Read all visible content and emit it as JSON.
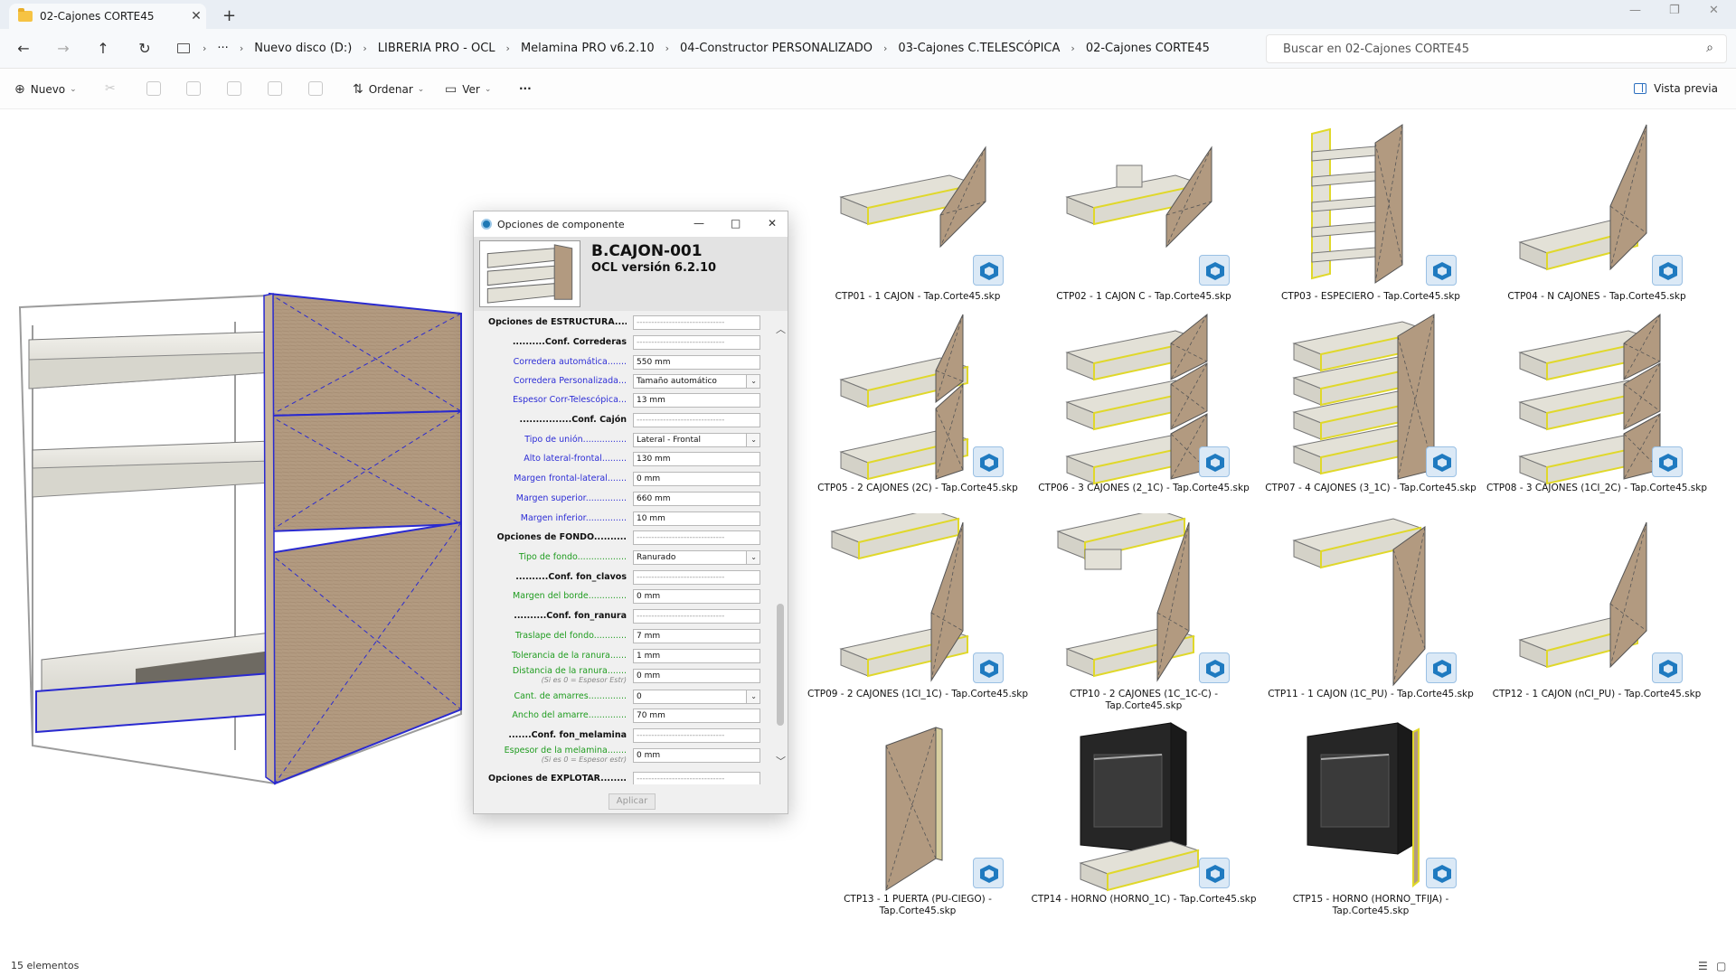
{
  "tab": {
    "title": "02-Cajones CORTE45",
    "close": "✕",
    "new": "+"
  },
  "window": {
    "minimize": "—",
    "restore": "❐",
    "close": "✕"
  },
  "nav": {
    "back": "←",
    "forward": "→",
    "up": "↑",
    "refresh": "↻",
    "more": "···",
    "sep": "›",
    "breadcrumbs": [
      "Nuevo disco (D:)",
      "LIBRERIA PRO - OCL",
      "Melamina PRO v6.2.10",
      "04-Constructor PERSONALIZADO",
      "03-Cajones C.TELESCÓPICA",
      "02-Cajones CORTE45"
    ],
    "search_placeholder": "Buscar en 02-Cajones CORTE45"
  },
  "toolbar": {
    "new_label": "Nuevo",
    "sort_label": "Ordenar",
    "view_label": "Ver",
    "more": "···",
    "preview_label": "Vista previa"
  },
  "dialog": {
    "title": "Opciones de componente",
    "component_name": "B.CAJON-001",
    "version": "OCL versión 6.2.10",
    "apply_label": "Aplicar",
    "rows": [
      {
        "label": "Opciones de ESTRUCTURA.......",
        "style": "sec",
        "value": "------------------------------",
        "kind": "dash"
      },
      {
        "label": "..........Conf. Correderas",
        "style": "sec",
        "value": "------------------------------",
        "kind": "dash"
      },
      {
        "label": "Corredera automática.......",
        "style": "blue",
        "value": "550 mm",
        "kind": "text"
      },
      {
        "label": "Corredera Personalizada...",
        "style": "blue",
        "value": "Tamaño automático",
        "kind": "select"
      },
      {
        "label": "Espesor Corr-Telescópica...",
        "style": "blue",
        "value": "13 mm",
        "kind": "text"
      },
      {
        "label": "................Conf. Cajón",
        "style": "sec",
        "value": "------------------------------",
        "kind": "dash"
      },
      {
        "label": "Tipo de unión................",
        "style": "blue",
        "value": "Lateral - Frontal",
        "kind": "select"
      },
      {
        "label": "Alto lateral-frontal.........",
        "style": "blue",
        "value": "130 mm",
        "kind": "text"
      },
      {
        "label": "Margen frontal-lateral.......",
        "style": "blue",
        "value": "0 mm",
        "kind": "text"
      },
      {
        "label": "Margen superior...............",
        "style": "blue",
        "value": "660 mm",
        "kind": "text"
      },
      {
        "label": "Margen inferior...............",
        "style": "blue",
        "value": "10 mm",
        "kind": "text"
      },
      {
        "label": "Opciones de FONDO..........",
        "style": "sec",
        "value": "------------------------------",
        "kind": "dash"
      },
      {
        "label": "Tipo de fondo..................",
        "style": "green",
        "value": "Ranurado",
        "kind": "select"
      },
      {
        "label": "..........Conf. fon_clavos",
        "style": "sec",
        "value": "------------------------------",
        "kind": "dash"
      },
      {
        "label": "Margen del borde..............",
        "style": "green",
        "value": "0 mm",
        "kind": "text"
      },
      {
        "label": "..........Conf. fon_ranura",
        "style": "sec",
        "value": "------------------------------",
        "kind": "dash"
      },
      {
        "label": "Traslape del fondo............",
        "style": "green",
        "value": "7 mm",
        "kind": "text"
      },
      {
        "label": "Tolerancia de la ranura......",
        "style": "green",
        "value": "1 mm",
        "kind": "text"
      },
      {
        "label": "Distancia de la ranura.......",
        "style": "green",
        "value": "0 mm",
        "kind": "text",
        "sub": "(Si es 0 = Espesor Estr)"
      },
      {
        "label": "Cant. de amarres..............",
        "style": "green",
        "value": "0",
        "kind": "select"
      },
      {
        "label": "Ancho del amarre..............",
        "style": "green",
        "value": "70 mm",
        "kind": "text"
      },
      {
        "label": ".......Conf. fon_melamina",
        "style": "sec",
        "value": "------------------------------",
        "kind": "dash"
      },
      {
        "label": "Espesor de la melamina.......",
        "style": "green",
        "value": "0 mm",
        "kind": "text",
        "sub": "(Si es 0 = Espesor estr)"
      },
      {
        "label": "Opciones de EXPLOTAR.........",
        "style": "sec",
        "value": "------------------------------",
        "kind": "dash"
      }
    ]
  },
  "files": [
    {
      "name": "CTP01 - 1 CAJON - Tap.Corte45.skp",
      "variant": "1c"
    },
    {
      "name": "CTP02 - 1 CAJON C - Tap.Corte45.skp",
      "variant": "1cc"
    },
    {
      "name": "CTP03 - ESPECIERO - Tap.Corte45.skp",
      "variant": "esp"
    },
    {
      "name": "CTP04 - N CAJONES - Tap.Corte45.skp",
      "variant": "n"
    },
    {
      "name": "CTP05 - 2 CAJONES (2C) - Tap.Corte45.skp",
      "variant": "2c"
    },
    {
      "name": "CTP06 - 3 CAJONES (2_1C) - Tap.Corte45.skp",
      "variant": "3c"
    },
    {
      "name": "CTP07 - 4 CAJONES (3_1C) - Tap.Corte45.skp",
      "variant": "4c"
    },
    {
      "name": "CTP08 - 3 CAJONES (1CI_2C) - Tap.Corte45.skp",
      "variant": "3c2"
    },
    {
      "name": "CTP09 - 2 CAJONES (1CI_1C) - Tap.Corte45.skp",
      "variant": "2ci"
    },
    {
      "name": "CTP10 - 2 CAJONES (1C_1C-C) - Tap.Corte45.skp",
      "variant": "2cc"
    },
    {
      "name": "CTP11 - 1 CAJON (1C_PU) - Tap.Corte45.skp",
      "variant": "1pu"
    },
    {
      "name": "CTP12 - 1 CAJON (nCI_PU) - Tap.Corte45.skp",
      "variant": "npu"
    },
    {
      "name": "CTP13 - 1 PUERTA (PU-CIEGO) - Tap.Corte45.skp",
      "variant": "door"
    },
    {
      "name": "CTP14 - HORNO (HORNO_1C) - Tap.Corte45.skp",
      "variant": "oven1"
    },
    {
      "name": "CTP15 - HORNO (HORNO_TFIJA) - Tap.Corte45.skp",
      "variant": "oven2"
    }
  ],
  "status": {
    "count_label": "15 elementos"
  },
  "icons": {
    "folder": "folder-icon",
    "search": "search-icon",
    "sketchup": "sketchup-file-icon"
  },
  "colors": {
    "wood": "#b29a80",
    "tray": "#e3e1d7",
    "edge": "#e0d82a",
    "selection": "#2a2ad0",
    "oven": "#262626"
  }
}
